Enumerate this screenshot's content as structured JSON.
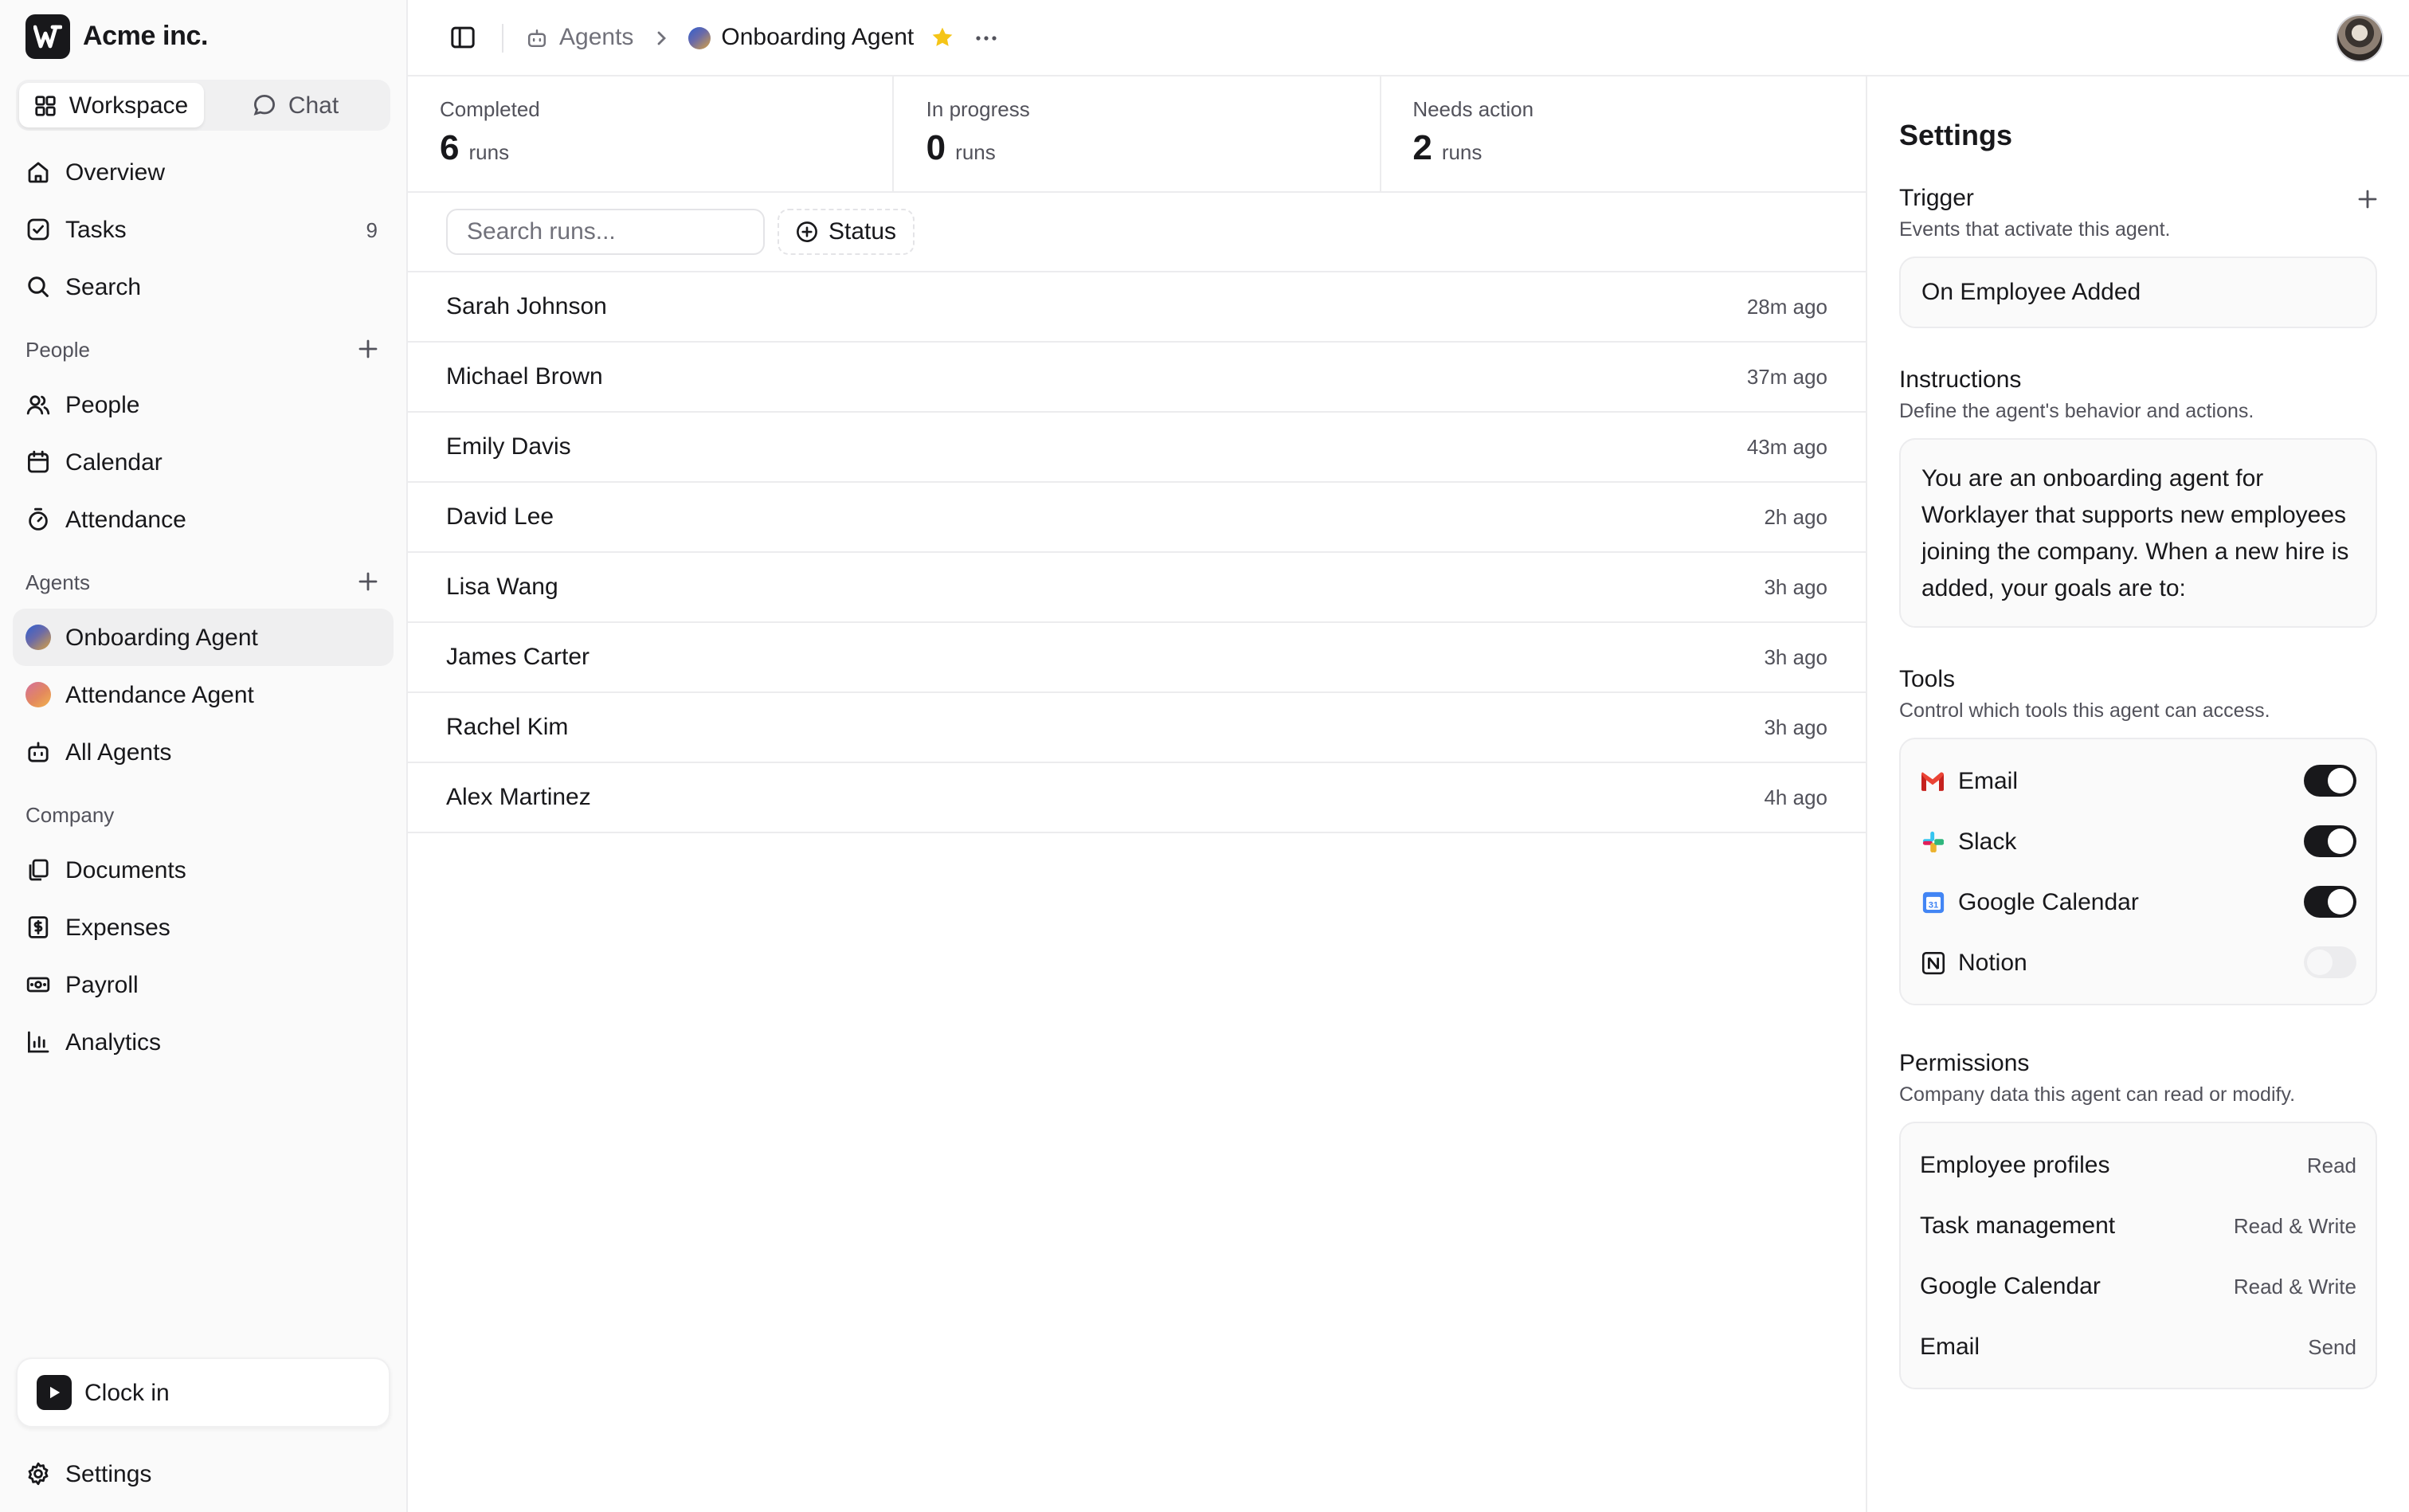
{
  "brand": {
    "name": "Acme inc.",
    "logo_icon": "worklayer-logo-icon"
  },
  "switcher": {
    "workspace": "Workspace",
    "chat": "Chat"
  },
  "nav": {
    "top": [
      {
        "label": "Overview",
        "icon": "home-icon"
      },
      {
        "label": "Tasks",
        "icon": "check-square-icon",
        "count": "9"
      },
      {
        "label": "Search",
        "icon": "search-icon"
      }
    ],
    "people_header": "People",
    "people": [
      {
        "label": "People",
        "icon": "users-icon"
      },
      {
        "label": "Calendar",
        "icon": "calendar-icon"
      },
      {
        "label": "Attendance",
        "icon": "timer-icon"
      }
    ],
    "agents_header": "Agents",
    "agents": [
      {
        "label": "Onboarding Agent",
        "icon": "agent-avatar-icon"
      },
      {
        "label": "Attendance Agent",
        "icon": "agent-avatar-icon"
      },
      {
        "label": "All Agents",
        "icon": "bot-icon"
      }
    ],
    "company_header": "Company",
    "company": [
      {
        "label": "Documents",
        "icon": "documents-icon"
      },
      {
        "label": "Expenses",
        "icon": "receipt-icon"
      },
      {
        "label": "Payroll",
        "icon": "banknote-icon"
      },
      {
        "label": "Analytics",
        "icon": "bar-chart-icon"
      }
    ],
    "clock_in": "Clock in",
    "settings": "Settings"
  },
  "breadcrumb": {
    "parent": "Agents",
    "current": "Onboarding Agent"
  },
  "stats": [
    {
      "label": "Completed",
      "value": "6",
      "unit": "runs"
    },
    {
      "label": "In progress",
      "value": "0",
      "unit": "runs"
    },
    {
      "label": "Needs action",
      "value": "2",
      "unit": "runs"
    }
  ],
  "filters": {
    "search_placeholder": "Search runs...",
    "status_label": "Status"
  },
  "runs": [
    {
      "name": "Sarah Johnson",
      "time": "28m ago"
    },
    {
      "name": "Michael Brown",
      "time": "37m ago"
    },
    {
      "name": "Emily Davis",
      "time": "43m ago"
    },
    {
      "name": "David Lee",
      "time": "2h ago"
    },
    {
      "name": "Lisa Wang",
      "time": "3h ago"
    },
    {
      "name": "James Carter",
      "time": "3h ago"
    },
    {
      "name": "Rachel Kim",
      "time": "3h ago"
    },
    {
      "name": "Alex Martinez",
      "time": "4h ago"
    }
  ],
  "settings": {
    "title": "Settings",
    "trigger": {
      "title": "Trigger",
      "subtitle": "Events that activate this agent.",
      "value": "On Employee Added"
    },
    "instructions": {
      "title": "Instructions",
      "subtitle": "Define the agent's behavior and actions.",
      "text": "You are an onboarding agent for Worklayer that supports new employees joining the company. When a new hire is added, your goals are to:"
    },
    "tools": {
      "title": "Tools",
      "subtitle": "Control which tools this agent can access.",
      "items": [
        {
          "label": "Email",
          "icon": "gmail-icon",
          "enabled": true
        },
        {
          "label": "Slack",
          "icon": "slack-icon",
          "enabled": true
        },
        {
          "label": "Google Calendar",
          "icon": "google-calendar-icon",
          "enabled": true
        },
        {
          "label": "Notion",
          "icon": "notion-icon",
          "enabled": false
        }
      ]
    },
    "permissions": {
      "title": "Permissions",
      "subtitle": "Company data this agent can read or modify.",
      "items": [
        {
          "label": "Employee profiles",
          "value": "Read"
        },
        {
          "label": "Task management",
          "value": "Read & Write"
        },
        {
          "label": "Google Calendar",
          "value": "Read & Write"
        },
        {
          "label": "Email",
          "value": "Send"
        }
      ]
    }
  },
  "colors": {
    "accent_dark": "#18181b",
    "star": "#f5c518",
    "muted_text": "#52525b",
    "border": "#ececee"
  }
}
